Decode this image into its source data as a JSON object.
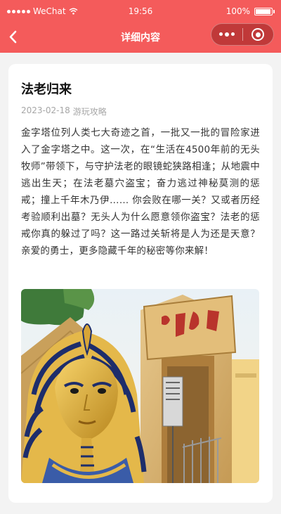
{
  "status_bar": {
    "carrier": "WeChat",
    "time": "19:56",
    "battery": "100%",
    "battery_level": 1.0
  },
  "nav": {
    "title": "详细内容",
    "back_icon": "chevron-left-icon",
    "more_icon": "more-dots-icon",
    "close_icon": "target-close-icon"
  },
  "article": {
    "title": "法老归来",
    "date": "2023-02-18",
    "category": "游玩攻略",
    "body": "金字塔位列人类七大奇迹之首，一批又一批的冒险家进入了金字塔之中。这一次，在“生活在4500年前的无头牧师”带领下，与守护法老的眼镜蛇狭路相逢；从地震中逃出生天；在法老墓穴盗宝；奋力逃过神秘莫测的惩戒；撞上千年木乃伊…… 你会败在哪一关？又或者历经考验顺利出墓？无头人为什么愿意领你盗宝？法老的惩戒你真的躲过了吗？这一路过关斩将是人为还是天意？亲爱的勇士，更多隐藏千年的秘密等你来解！",
    "image_sign_text": "法老归来"
  },
  "colors": {
    "header": "#f45b5b",
    "background": "#f3f3f3"
  }
}
